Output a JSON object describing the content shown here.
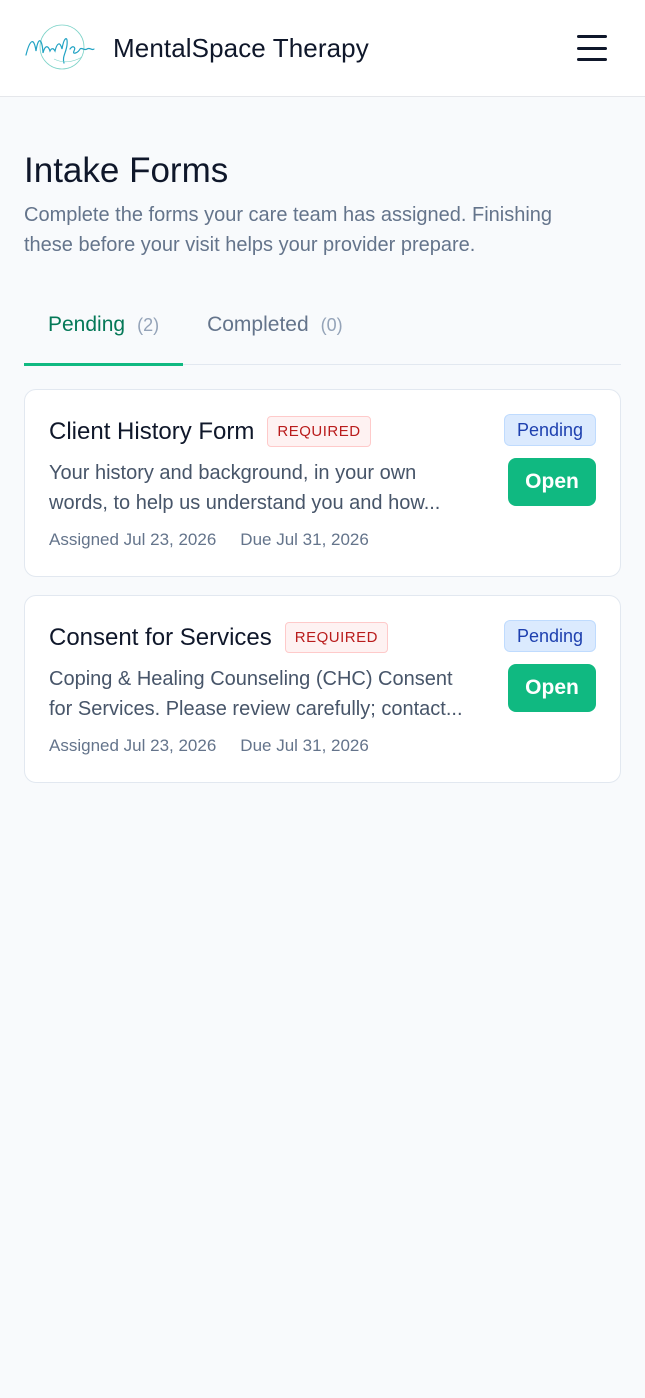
{
  "header": {
    "app_title": "MentalSpace Therapy",
    "logo_text": "MentalSpace",
    "menu_icon": "hamburger-icon"
  },
  "page": {
    "title": "Intake Forms",
    "subtitle": "Complete the forms your care team has assigned. Finishing these before your visit helps your provider prepare."
  },
  "tabs": [
    {
      "label": "Pending",
      "count": "(2)",
      "active": true
    },
    {
      "label": "Completed",
      "count": "(0)",
      "active": false
    }
  ],
  "forms": [
    {
      "title": "Client History Form",
      "required_label": "REQUIRED",
      "description": "Your history and background, in your own words, to help us understand you and how...",
      "assigned": "Assigned Jul 23, 2026",
      "due": "Due Jul 31, 2026",
      "status": "Pending",
      "action_label": "Open"
    },
    {
      "title": "Consent for Services",
      "required_label": "REQUIRED",
      "description": "Coping & Healing Counseling (CHC) Consent for Services. Please review carefully; contact...",
      "assigned": "Assigned Jul 23, 2026",
      "due": "Due Jul 31, 2026",
      "status": "Pending",
      "action_label": "Open"
    }
  ],
  "colors": {
    "accent": "#10b981",
    "accent_dark": "#047857",
    "required_text": "#b91c1c",
    "pending_badge_bg": "#dbeafe",
    "pending_badge_text": "#1e40af"
  }
}
